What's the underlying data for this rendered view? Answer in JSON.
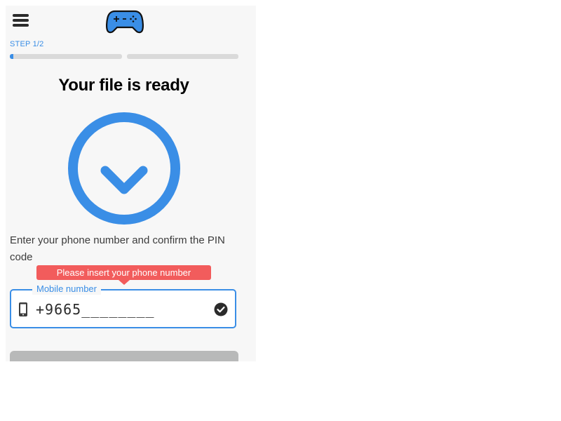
{
  "header": {
    "menu_icon": "hamburger-menu-icon",
    "logo_icon": "gamepad-icon",
    "logo_color": "#3a8ee6"
  },
  "progress": {
    "step_label": "STEP 1/2",
    "step1_fill_percent": 3,
    "step2_fill_percent": 0,
    "accent_color": "#3a8ee6"
  },
  "main": {
    "title": "Your file is ready",
    "download_icon": "download-arrow-circle-icon",
    "instructions": "Enter your phone number and confirm the PIN code"
  },
  "form": {
    "tooltip": "Please insert your phone number",
    "tooltip_color": "#f25c5c",
    "field_label": "Mobile number",
    "phone_value": "+9665________",
    "phone_icon": "mobile-phone-icon",
    "valid_icon": "check-circle-icon"
  },
  "submit": {
    "label": ""
  }
}
